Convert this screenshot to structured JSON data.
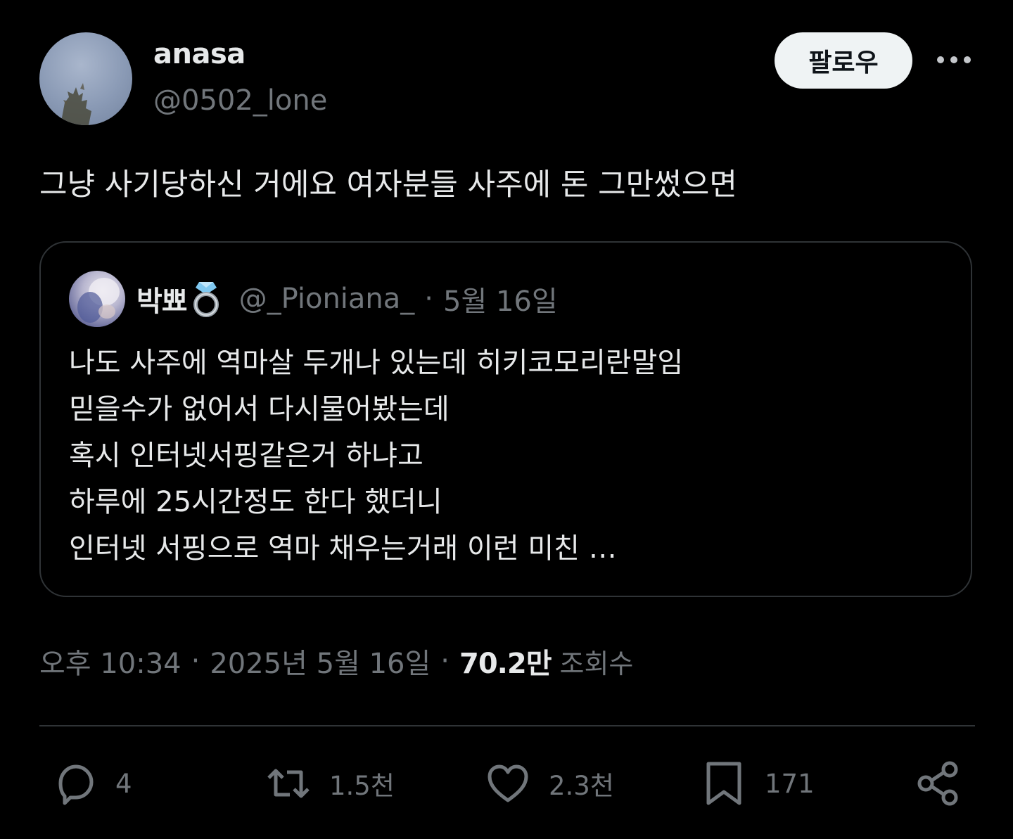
{
  "author": {
    "display_name": "anasa",
    "handle": "@0502_lone"
  },
  "follow_button_label": "팔로우",
  "tweet_text": "그냥 사기당하신 거에요 여자분들 사주에 돈 그만썼으면",
  "quoted_tweet": {
    "display_name": "박뾰",
    "emoji_icon": "ring-icon",
    "handle": "@_Pioniana_",
    "separator": "·",
    "date": "5월 16일",
    "lines": [
      "나도 사주에 역마살 두개나 있는데 히키코모리란말임",
      "믿을수가 없어서 다시물어봤는데",
      "혹시 인터넷서핑같은거 하냐고",
      "하루에 25시간정도 한다 했더니",
      "인터넷 서핑으로 역마 채우는거래 이런 미친 …"
    ]
  },
  "meta": {
    "time": "오후 10:34",
    "separator": "·",
    "date": "2025년 5월 16일",
    "views_count": "70.2만",
    "views_label": "조회수"
  },
  "actions": {
    "reply_count": "4",
    "retweet_count": "1.5천",
    "like_count": "2.3천",
    "bookmark_count": "171"
  },
  "colors": {
    "background": "#000000",
    "primary_text": "#e7e9ea",
    "secondary_text": "#71767b",
    "border": "#2f3336",
    "follow_button_bg": "#eff3f4"
  }
}
